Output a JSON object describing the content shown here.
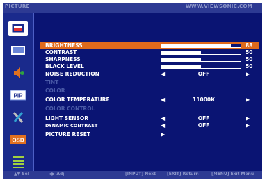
{
  "header": {
    "title": "PICTURE",
    "site": "WWW.VIEWSONIC.COM"
  },
  "sidebar": {
    "items": [
      {
        "icon": "picture-icon",
        "selected": true
      },
      {
        "icon": "screen-icon",
        "selected": false
      },
      {
        "icon": "audio-icon",
        "selected": false
      },
      {
        "icon": "pip-icon",
        "label": "PIP",
        "selected": false
      },
      {
        "icon": "setup-tools-icon",
        "selected": false
      },
      {
        "icon": "osd-icon",
        "label": "OSD",
        "selected": false
      },
      {
        "icon": "menu-list-icon",
        "selected": false
      }
    ]
  },
  "menu": {
    "rows": [
      {
        "label": "BRIGHTNESS",
        "type": "slider",
        "value": "88",
        "level": 0.88,
        "selected": true
      },
      {
        "label": "CONTRAST",
        "type": "slider",
        "value": "50",
        "level": 0.5
      },
      {
        "label": "SHARPNESS",
        "type": "slider",
        "value": "50",
        "level": 0.5
      },
      {
        "label": "BLACK LEVEL",
        "type": "slider",
        "value": "50",
        "level": 0.5
      },
      {
        "label": "NOISE REDUCTION",
        "type": "option",
        "value": "OFF"
      },
      {
        "label": "TINT",
        "type": "disabled"
      },
      {
        "label": "COLOR",
        "type": "disabled"
      },
      {
        "label": "COLOR TEMPERATURE",
        "type": "option",
        "value": "11000K"
      },
      {
        "label": "COLOR CONTROL",
        "type": "disabled"
      },
      {
        "label": "LIGHT SENSOR",
        "type": "option",
        "value": "OFF"
      },
      {
        "label": "DYNAMIC CONTRAST",
        "type": "option",
        "value": "OFF"
      },
      {
        "label": "PICTURE RESET",
        "type": "submenu"
      }
    ]
  },
  "footer": {
    "hints": [
      "▲▼ Sel",
      "◀▶ Adj",
      "[INPUT] Next",
      "[EXIT] Return",
      "[MENU] Exit Menu"
    ]
  },
  "colors": {
    "accent": "#e06a1c",
    "background": "#0a1473",
    "bar": "#2d3a93"
  }
}
